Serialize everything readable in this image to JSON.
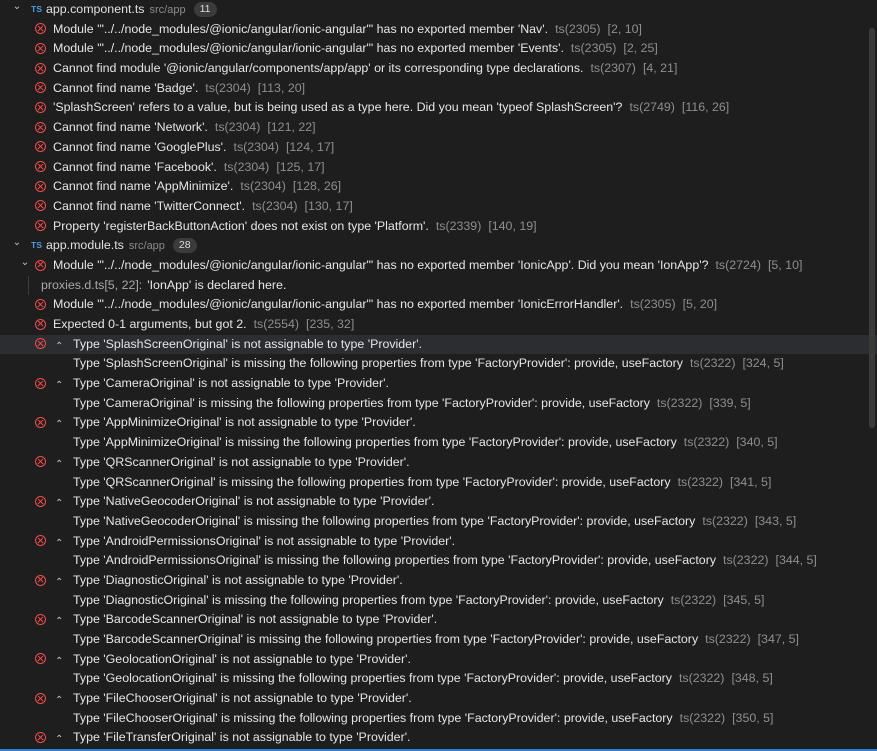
{
  "groups": [
    {
      "file": "app.component.ts",
      "path": "src/app",
      "count": "11",
      "ts_label": "TS",
      "problems": [
        {
          "type": "error",
          "message": "Module '\"../../node_modules/@ionic/angular/ionic-angular\"' has no exported member 'Nav'.",
          "code": "ts(2305)",
          "loc": "[2, 10]"
        },
        {
          "type": "error",
          "message": "Module '\"../../node_modules/@ionic/angular/ionic-angular\"' has no exported member 'Events'.",
          "code": "ts(2305)",
          "loc": "[2, 25]"
        },
        {
          "type": "error",
          "message": "Cannot find module '@ionic/angular/components/app/app' or its corresponding type declarations.",
          "code": "ts(2307)",
          "loc": "[4, 21]"
        },
        {
          "type": "error",
          "message": "Cannot find name 'Badge'.",
          "code": "ts(2304)",
          "loc": "[113, 20]"
        },
        {
          "type": "error",
          "message": "'SplashScreen' refers to a value, but is being used as a type here. Did you mean 'typeof SplashScreen'?",
          "code": "ts(2749)",
          "loc": "[116, 26]"
        },
        {
          "type": "error",
          "message": "Cannot find name 'Network'.",
          "code": "ts(2304)",
          "loc": "[121, 22]"
        },
        {
          "type": "error",
          "message": "Cannot find name 'GooglePlus'.",
          "code": "ts(2304)",
          "loc": "[124, 17]"
        },
        {
          "type": "error",
          "message": "Cannot find name 'Facebook'.",
          "code": "ts(2304)",
          "loc": "[125, 17]"
        },
        {
          "type": "error",
          "message": "Cannot find name 'AppMinimize'.",
          "code": "ts(2304)",
          "loc": "[128, 26]"
        },
        {
          "type": "error",
          "message": "Cannot find name 'TwitterConnect'.",
          "code": "ts(2304)",
          "loc": "[130, 17]"
        },
        {
          "type": "error",
          "message": "Property 'registerBackButtonAction' does not exist on type 'Platform'.",
          "code": "ts(2339)",
          "loc": "[140, 19]"
        }
      ]
    },
    {
      "file": "app.module.ts",
      "path": "src/app",
      "count": "28",
      "ts_label": "TS",
      "problems": [
        {
          "type": "error",
          "expandable": true,
          "message": "Module '\"../../node_modules/@ionic/angular/ionic-angular\"' has no exported member 'IonicApp'. Did you mean 'IonApp'?",
          "code": "ts(2724)",
          "loc": "[5, 10]"
        },
        {
          "type": "related",
          "file": "proxies.d.ts[5, 22]:",
          "message": "'IonApp' is declared here."
        },
        {
          "type": "error",
          "message": "Module '\"../../node_modules/@ionic/angular/ionic-angular\"' has no exported member 'IonicErrorHandler'.",
          "code": "ts(2305)",
          "loc": "[5, 20]"
        },
        {
          "type": "error",
          "message": "Expected 0-1 arguments, but got 2.",
          "code": "ts(2554)",
          "loc": "[235, 32]"
        },
        {
          "type": "error",
          "caret": true,
          "selected": true,
          "message": "Type 'SplashScreenOriginal' is not assignable to type 'Provider'.",
          "detail": "Type 'SplashScreenOriginal' is missing the following properties from type 'FactoryProvider': provide, useFactory",
          "code": "ts(2322)",
          "loc": "[324, 5]"
        },
        {
          "type": "error",
          "caret": true,
          "message": "Type 'CameraOriginal' is not assignable to type 'Provider'.",
          "detail": "Type 'CameraOriginal' is missing the following properties from type 'FactoryProvider': provide, useFactory",
          "code": "ts(2322)",
          "loc": "[339, 5]"
        },
        {
          "type": "error",
          "caret": true,
          "message": "Type 'AppMinimizeOriginal' is not assignable to type 'Provider'.",
          "detail": "Type 'AppMinimizeOriginal' is missing the following properties from type 'FactoryProvider': provide, useFactory",
          "code": "ts(2322)",
          "loc": "[340, 5]"
        },
        {
          "type": "error",
          "caret": true,
          "message": "Type 'QRScannerOriginal' is not assignable to type 'Provider'.",
          "detail": "Type 'QRScannerOriginal' is missing the following properties from type 'FactoryProvider': provide, useFactory",
          "code": "ts(2322)",
          "loc": "[341, 5]"
        },
        {
          "type": "error",
          "caret": true,
          "message": "Type 'NativeGeocoderOriginal' is not assignable to type 'Provider'.",
          "detail": "Type 'NativeGeocoderOriginal' is missing the following properties from type 'FactoryProvider': provide, useFactory",
          "code": "ts(2322)",
          "loc": "[343, 5]"
        },
        {
          "type": "error",
          "caret": true,
          "message": "Type 'AndroidPermissionsOriginal' is not assignable to type 'Provider'.",
          "detail": "Type 'AndroidPermissionsOriginal' is missing the following properties from type 'FactoryProvider': provide, useFactory",
          "code": "ts(2322)",
          "loc": "[344, 5]"
        },
        {
          "type": "error",
          "caret": true,
          "message": "Type 'DiagnosticOriginal' is not assignable to type 'Provider'.",
          "detail": "Type 'DiagnosticOriginal' is missing the following properties from type 'FactoryProvider': provide, useFactory",
          "code": "ts(2322)",
          "loc": "[345, 5]"
        },
        {
          "type": "error",
          "caret": true,
          "message": "Type 'BarcodeScannerOriginal' is not assignable to type 'Provider'.",
          "detail": "Type 'BarcodeScannerOriginal' is missing the following properties from type 'FactoryProvider': provide, useFactory",
          "code": "ts(2322)",
          "loc": "[347, 5]"
        },
        {
          "type": "error",
          "caret": true,
          "message": "Type 'GeolocationOriginal' is not assignable to type 'Provider'.",
          "detail": "Type 'GeolocationOriginal' is missing the following properties from type 'FactoryProvider': provide, useFactory",
          "code": "ts(2322)",
          "loc": "[348, 5]"
        },
        {
          "type": "error",
          "caret": true,
          "message": "Type 'FileChooserOriginal' is not assignable to type 'Provider'.",
          "detail": "Type 'FileChooserOriginal' is missing the following properties from type 'FactoryProvider': provide, useFactory",
          "code": "ts(2322)",
          "loc": "[350, 5]"
        },
        {
          "type": "error",
          "caret": true,
          "message": "Type 'FileTransferOriginal' is not assignable to type 'Provider'."
        }
      ]
    }
  ],
  "icons": {
    "chevron_down": "chevron-down-icon",
    "error": "error-icon",
    "caret_up": "caret-up-icon"
  },
  "colors": {
    "background": "#1e1e1e",
    "error": "#f14c4c",
    "ts_icon": "#4a9ee8",
    "selected_row": "#2b2d31"
  }
}
